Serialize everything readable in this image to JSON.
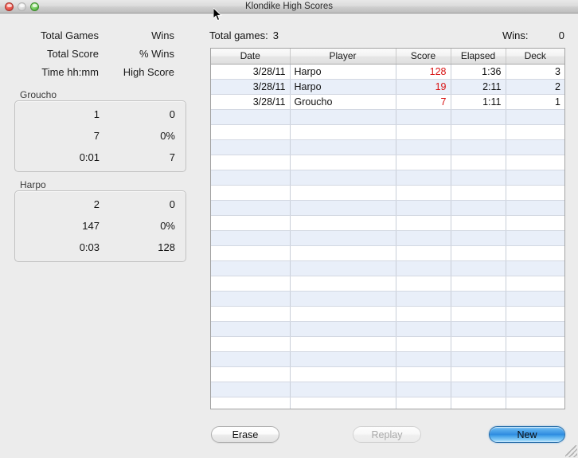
{
  "window": {
    "title": "Klondike High Scores",
    "traffic_lights": [
      "close",
      "minimize",
      "zoom"
    ]
  },
  "left_panel": {
    "legend_rows": [
      {
        "a": "Total Games",
        "b": "Wins"
      },
      {
        "a": "Total Score",
        "b": "% Wins"
      },
      {
        "a": "Time hh:mm",
        "b": "High Score"
      }
    ],
    "groups": [
      {
        "title": "Groucho",
        "rows": [
          {
            "a": "1",
            "b": "0"
          },
          {
            "a": "7",
            "b": "0%"
          },
          {
            "a": "0:01",
            "b": "7"
          }
        ]
      },
      {
        "title": "Harpo",
        "rows": [
          {
            "a": "2",
            "b": "0"
          },
          {
            "a": "147",
            "b": "0%"
          },
          {
            "a": "0:03",
            "b": "128"
          }
        ]
      }
    ]
  },
  "summary": {
    "total_games_label": "Total games:",
    "total_games_value": "3",
    "wins_label": "Wins:",
    "wins_value": "0"
  },
  "table": {
    "columns": [
      "Date",
      "Player",
      "Score",
      "Elapsed",
      "Deck"
    ],
    "rows": [
      {
        "date": "3/28/11",
        "player": "Harpo",
        "score": "128",
        "elapsed": "1:36",
        "deck": "3"
      },
      {
        "date": "3/28/11",
        "player": "Harpo",
        "score": "19",
        "elapsed": "2:11",
        "deck": "2"
      },
      {
        "date": "3/28/11",
        "player": "Groucho",
        "score": "7",
        "elapsed": "1:11",
        "deck": "1"
      }
    ],
    "empty_row_count": 21,
    "score_color": "#d81313",
    "alt_row_color": "#e9eff9"
  },
  "buttons": {
    "erase": "Erase",
    "replay": "Replay",
    "new": "New"
  }
}
